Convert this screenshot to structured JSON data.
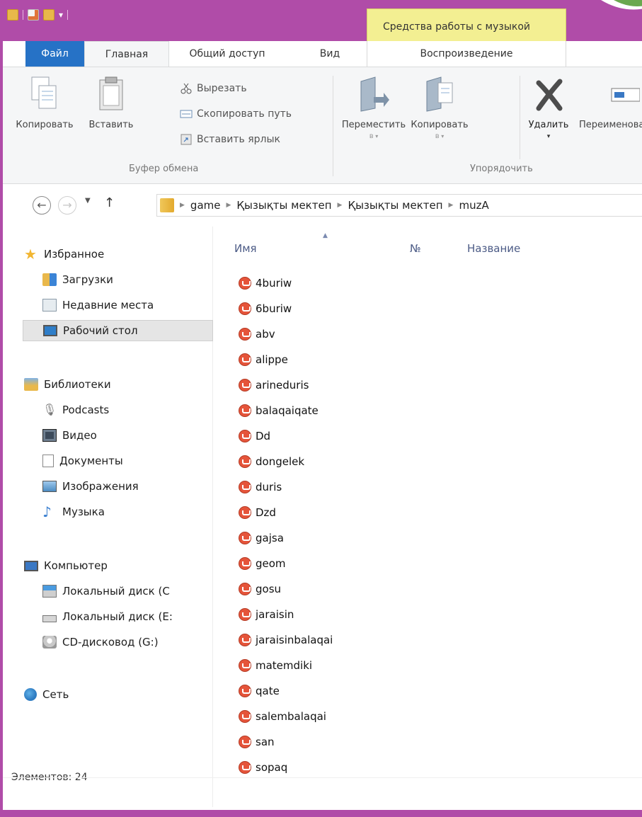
{
  "colors": {
    "frame": "#b04ca8",
    "file_tab": "#2672c6",
    "context": "#f3ef92",
    "sort_column": "#4c5b86"
  },
  "context_tab_title": "Средства работы с музыкой",
  "tabs": {
    "file": "Файл",
    "home": "Главная",
    "share": "Общий доступ",
    "view": "Вид",
    "play": "Воспроизведение"
  },
  "ribbon": {
    "copy": "Копировать",
    "paste": "Вставить",
    "cut": "Вырезать",
    "copy_path": "Скопировать путь",
    "paste_shortcut": "Вставить ярлык",
    "clipboard_group": "Буфер обмена",
    "move_to": "Переместить",
    "move_to_sub": "в",
    "copy_to": "Копировать",
    "copy_to_sub": "в",
    "delete": "Удалить",
    "rename": "Переименовать",
    "organize_group": "Упорядочить"
  },
  "address": {
    "crumbs": [
      "game",
      "Қызықты мектеп",
      "Қызықты мектеп",
      "muzA"
    ]
  },
  "nav": {
    "favorites": "Избранное",
    "downloads": "Загрузки",
    "recent": "Недавние места",
    "desktop": "Рабочий стол",
    "libraries": "Библиотеки",
    "podcasts": "Podcasts",
    "video": "Видео",
    "documents": "Документы",
    "images": "Изображения",
    "music": "Музыка",
    "computer": "Компьютер",
    "disk_c": "Локальный диск (C",
    "disk_e": "Локальный диск (E:",
    "cd": "CD-дисковод (G:)",
    "network": "Сеть"
  },
  "columns": {
    "name": "Имя",
    "number": "№",
    "title": "Название"
  },
  "files": [
    "4buriw",
    "6buriw",
    "abv",
    "alippe",
    "arineduris",
    "balaqaiqate",
    "Dd",
    "dongelek",
    "duris",
    "Dzd",
    "gajsa",
    "geom",
    "gosu",
    "jaraisin",
    "jaraisinbalaqai",
    "matemdiki",
    "qate",
    "salembalaqai",
    "san",
    "sopaq"
  ],
  "status": "Элементов: 24",
  "icons": [
    "folder-icon",
    "new-document-icon",
    "dropdown-icon",
    "copy-icon",
    "paste-icon",
    "scissors-icon",
    "copy-path-icon",
    "paste-shortcut-icon",
    "move-to-icon",
    "copy-to-icon",
    "delete-icon",
    "rename-icon",
    "back-icon",
    "forward-icon",
    "up-icon",
    "star-icon",
    "downloads-icon",
    "recent-places-icon",
    "desktop-icon",
    "libraries-icon",
    "podcasts-icon",
    "video-icon",
    "documents-icon",
    "images-icon",
    "music-icon",
    "computer-icon",
    "disk-icon",
    "cd-drive-icon",
    "network-icon",
    "music-file-icon"
  ]
}
